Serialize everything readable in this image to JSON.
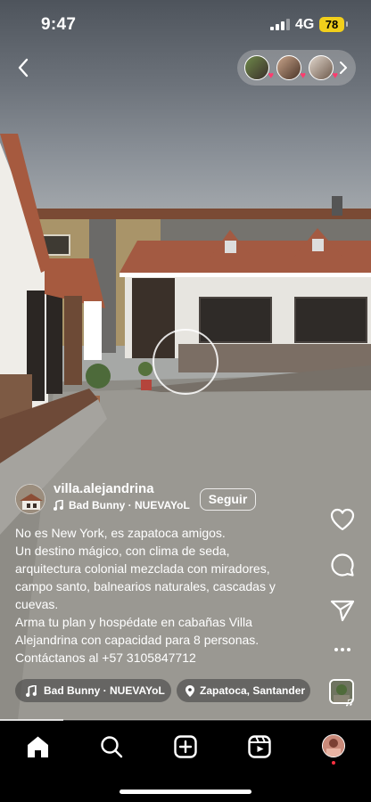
{
  "status_bar": {
    "time": "9:47",
    "network": "4G",
    "battery": "78"
  },
  "author": {
    "username": "villa.alejandrina",
    "audio": "Bad Bunny · NUEVAYoL",
    "follow_label": "Seguir"
  },
  "caption": {
    "lines": [
      "No es New York, es zapatoca amigos.",
      "Un destino mágico, con clima de seda,",
      "arquitectura colonial mezclada con miradores,",
      "campo santo, balnearios naturales, cascadas y",
      "cuevas.",
      "Arma tu plan y hospédate en cabañas Villa",
      "Alejandrina con capacidad para 8 personas.",
      "Contáctanos al +57 3105847712"
    ]
  },
  "pills": {
    "audio": "Bad Bunny · NUEVAYoL",
    "location": "Zapatoca, Santander"
  },
  "icons": {
    "back": "chevron-left-icon",
    "like": "heart-icon",
    "comment": "comment-icon",
    "share": "send-icon",
    "more": "more-icon",
    "tabs": [
      "home-icon",
      "search-icon",
      "create-icon",
      "reels-icon",
      "profile-avatar"
    ]
  },
  "colors": {
    "battery": "#f2cf1b",
    "story_heart": "#ff3b6e",
    "notification_dot": "#ff3040"
  },
  "video_progress": 0.17
}
